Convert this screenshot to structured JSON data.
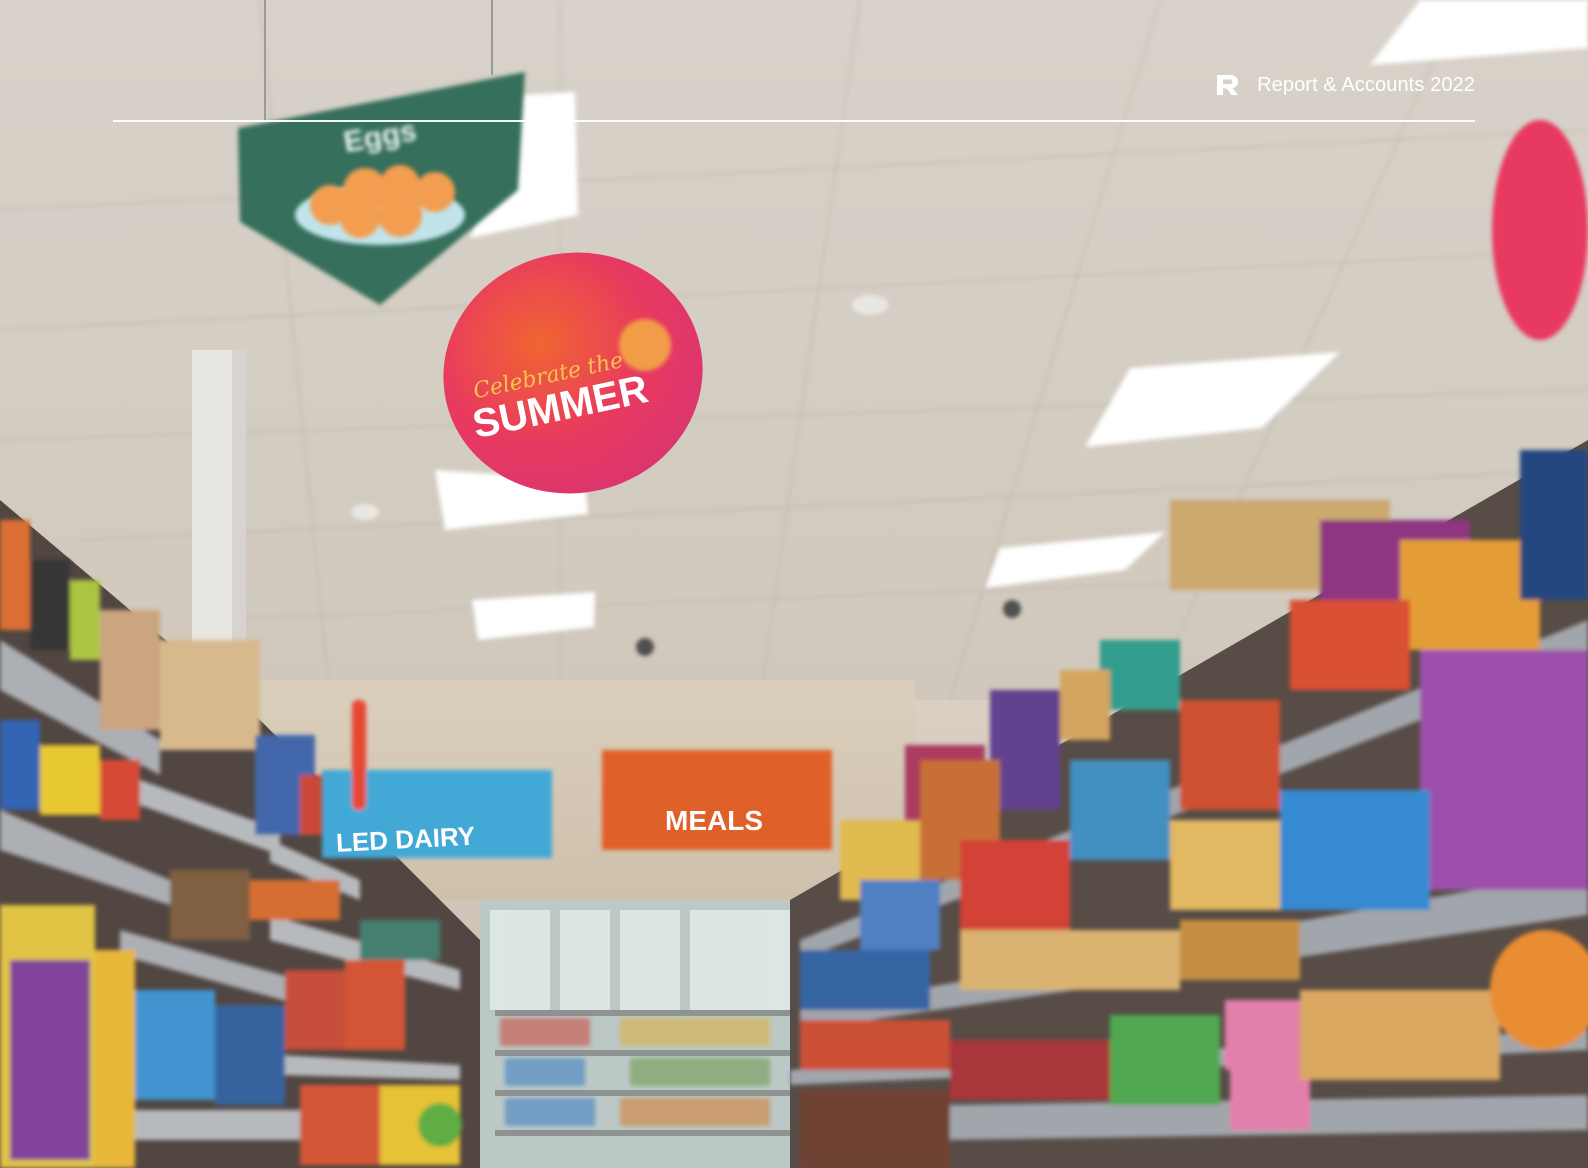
{
  "header": {
    "report_title": "Report & Accounts 2022",
    "brand_icon": "r-logo-icon"
  },
  "photo": {
    "signs": {
      "eggs": "Eggs",
      "summer_script": "Celebrate the",
      "summer": "SUMMER",
      "dairy": "LED DAIRY",
      "meals": "MEALS"
    }
  },
  "colors": {
    "eggs_sign": "#2f6b55",
    "summer_sign": "#e8315a",
    "dairy_sign": "#3aa6d6",
    "meals_sign": "#df5a22",
    "rule": "#ffffff"
  }
}
